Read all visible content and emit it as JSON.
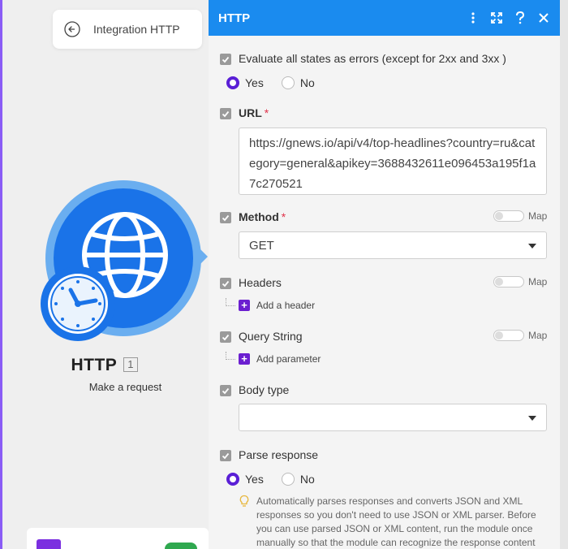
{
  "back_card": {
    "label": "Integration HTTP"
  },
  "module": {
    "name": "HTTP",
    "index": "1",
    "subtitle": "Make a request",
    "colors": {
      "primary": "#1a73e8",
      "ring": "#6aaef0"
    }
  },
  "panel": {
    "title": "HTTP",
    "header_icons": [
      "more-vertical-icon",
      "expand-icon",
      "help-icon",
      "close-icon"
    ],
    "accent": "#1a8bef",
    "fields": {
      "eval_errors": {
        "label": "Evaluate all states as errors (except for 2xx and 3xx )",
        "yes": "Yes",
        "no": "No",
        "selected": "Yes"
      },
      "url": {
        "label": "URL",
        "required": "*",
        "value": "https://gnews.io/api/v4/top-headlines?country=ru&category=general&apikey=3688432611e096453a195f1a7c270521"
      },
      "method": {
        "label": "Method",
        "required": "*",
        "value": "GET",
        "map_label": "Map"
      },
      "headers": {
        "label": "Headers",
        "map_label": "Map",
        "add_label": "Add a header"
      },
      "query_string": {
        "label": "Query String",
        "map_label": "Map",
        "add_label": "Add parameter"
      },
      "body_type": {
        "label": "Body type",
        "value": ""
      },
      "parse_response": {
        "label": "Parse response",
        "yes": "Yes",
        "no": "No",
        "selected": "Yes",
        "hint": "Automatically parses responses and converts JSON and XML responses so you don't need to use JSON or XML parser. Before you can use parsed JSON or XML content, run the module once manually so that the module can recognize the response content"
      }
    }
  }
}
